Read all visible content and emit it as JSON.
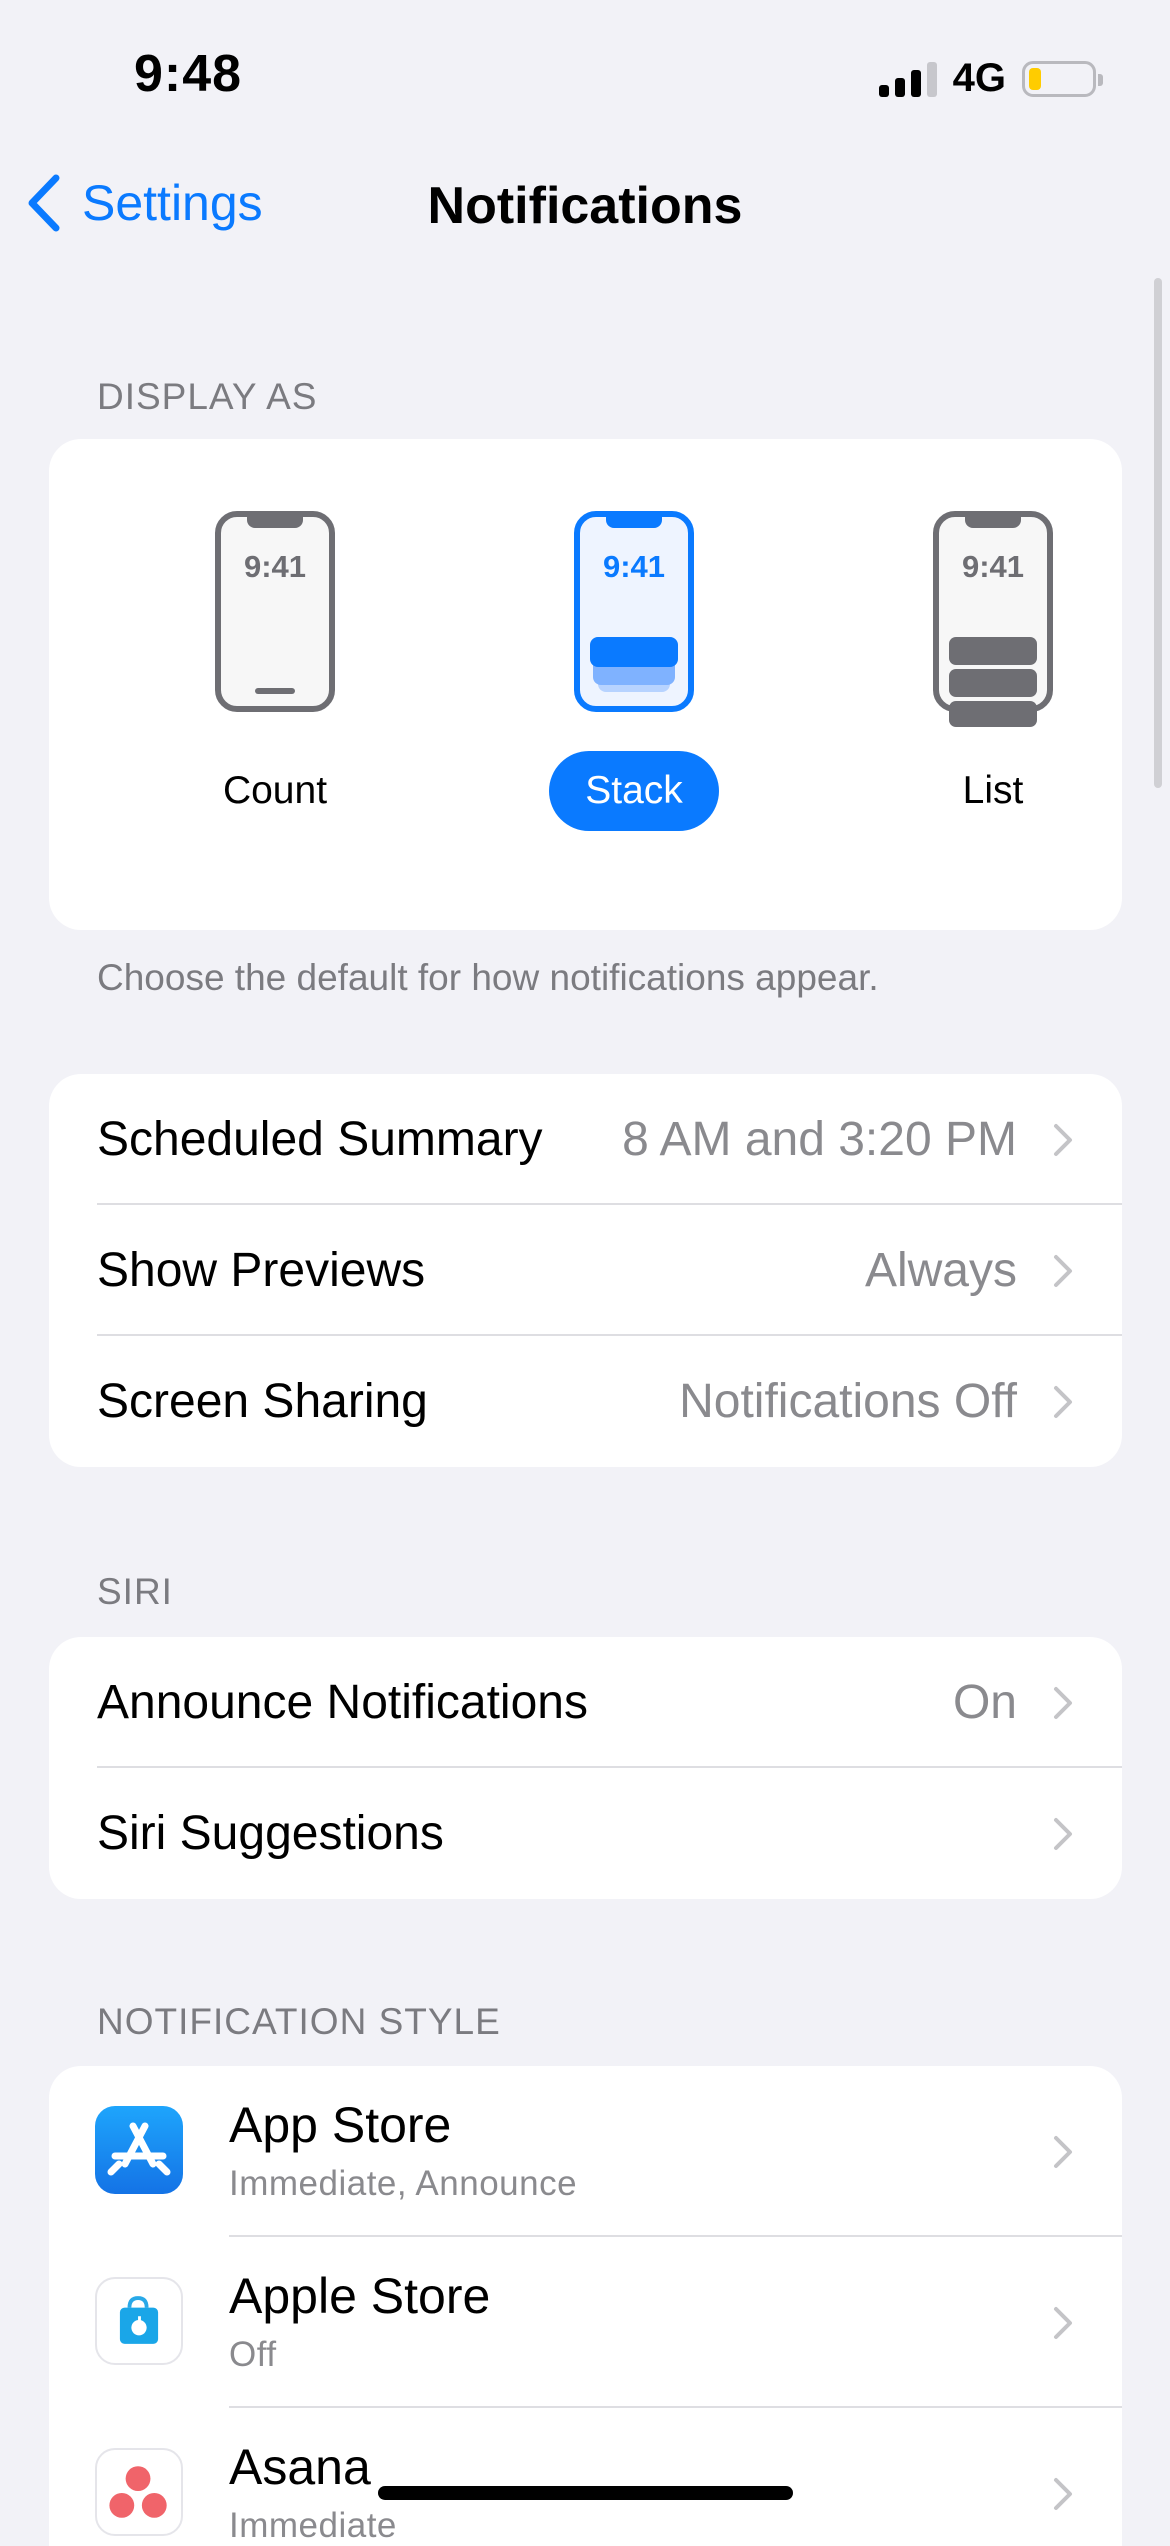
{
  "status_bar": {
    "time": "9:48",
    "network": "4G",
    "battery_level": 0.12
  },
  "nav": {
    "back_label": "Settings",
    "title": "Notifications"
  },
  "display_as": {
    "header": "DISPLAY AS",
    "phone_time": "9:41",
    "options": [
      {
        "label": "Count",
        "selected": false
      },
      {
        "label": "Stack",
        "selected": true
      },
      {
        "label": "List",
        "selected": false
      }
    ],
    "footer": "Choose the default for how notifications appear."
  },
  "general": {
    "rows": [
      {
        "label": "Scheduled Summary",
        "value": "8 AM and 3:20 PM"
      },
      {
        "label": "Show Previews",
        "value": "Always"
      },
      {
        "label": "Screen Sharing",
        "value": "Notifications Off"
      }
    ]
  },
  "siri": {
    "header": "SIRI",
    "rows": [
      {
        "label": "Announce Notifications",
        "value": "On"
      },
      {
        "label": "Siri Suggestions",
        "value": ""
      }
    ]
  },
  "notification_style": {
    "header": "NOTIFICATION STYLE",
    "apps": [
      {
        "name": "App Store",
        "detail": "Immediate, Announce",
        "icon": "app-store-icon"
      },
      {
        "name": "Apple Store",
        "detail": "Off",
        "icon": "apple-store-icon"
      },
      {
        "name": "Asana",
        "detail": "Immediate",
        "icon": "asana-icon"
      }
    ]
  },
  "colors": {
    "accent": "#0a7aff",
    "background": "#f2f2f7",
    "secondary_text": "#8a8a8e"
  }
}
